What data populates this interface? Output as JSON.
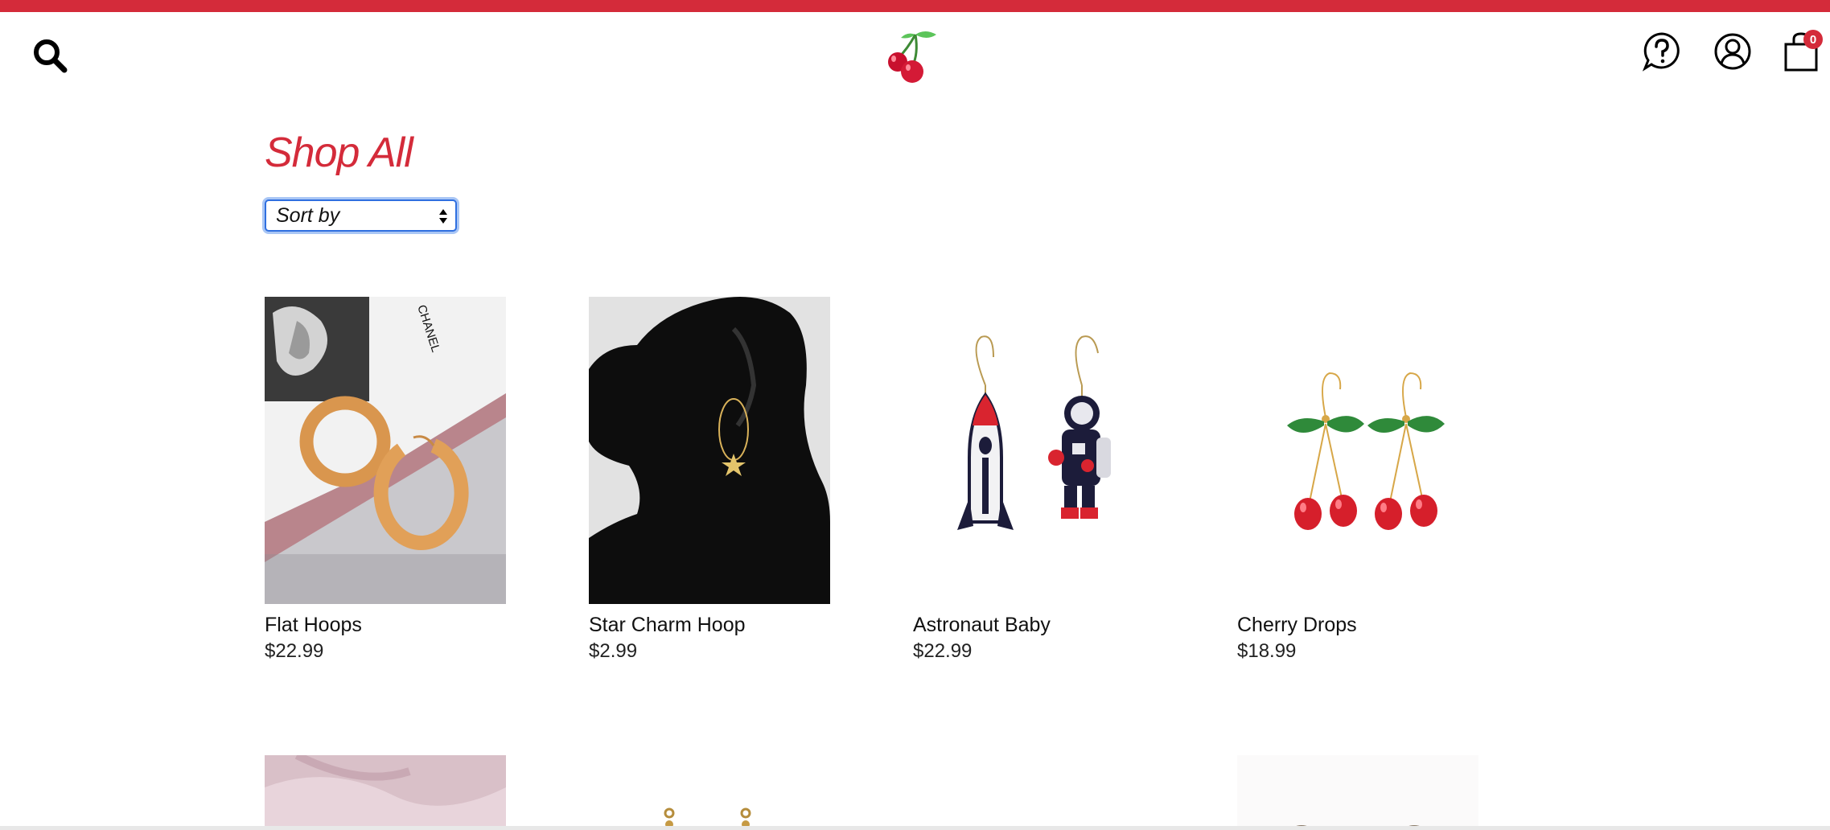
{
  "header": {
    "search_icon": "search-icon",
    "logo_icon": "cherry-logo-icon",
    "help_icon": "help-chat-icon",
    "account_icon": "user-account-icon",
    "cart_icon": "shopping-bag-icon",
    "cart_count": "0"
  },
  "colors": {
    "brand": "#d42b3a",
    "focus": "#2f6fe0"
  },
  "page": {
    "title": "Shop All"
  },
  "sort": {
    "label": "Sort by"
  },
  "products": [
    {
      "name": "Flat Hoops",
      "price": "$22.99"
    },
    {
      "name": "Star Charm Hoop",
      "price": "$2.99"
    },
    {
      "name": "Astronaut Baby",
      "price": "$22.99"
    },
    {
      "name": "Cherry Drops",
      "price": "$18.99"
    }
  ]
}
